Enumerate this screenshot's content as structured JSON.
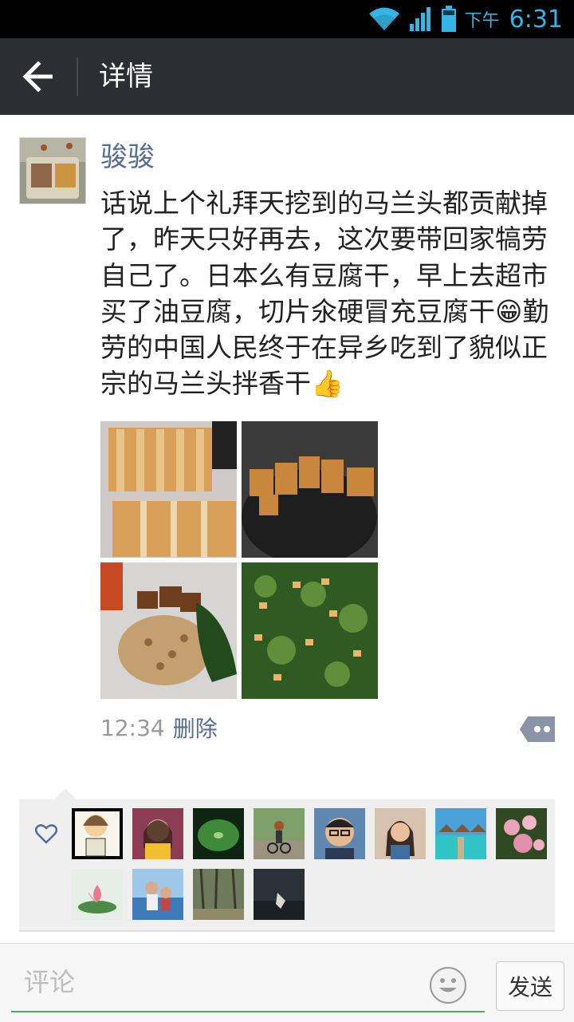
{
  "status_bar": {
    "ampm": "下午",
    "time": "6:31"
  },
  "header": {
    "title": "详情"
  },
  "post": {
    "username": "骏骏",
    "text": "话说上个礼拜天挖到的马兰头都贡献掉了，昨天只好再去，这次要带回家犒劳自己了。日本么有豆腐干，早上去超市买了油豆腐，切片氽硬冒充豆腐干😁勤劳的中国人民终于在异乡吃到了貌似正宗的马兰头拌香干👍",
    "photos": [
      {
        "icon": "photo-sliced-tofu"
      },
      {
        "icon": "photo-fried-tofu-pan"
      },
      {
        "icon": "photo-chopped-tofu-greens"
      },
      {
        "icon": "photo-malantou-salad"
      }
    ],
    "time": "12:34",
    "delete_label": "删除"
  },
  "likes": {
    "icon": "heart-icon",
    "avatars": [
      "avatar-cartoon",
      "avatar-woman-smiling",
      "avatar-lotus-leaf",
      "avatar-cyclist",
      "avatar-man-glasses",
      "avatar-woman-portrait",
      "avatar-beach-resort",
      "avatar-pink-roses",
      "avatar-lotus-flower",
      "avatar-child-beach",
      "avatar-forest-path",
      "avatar-dark-sky"
    ]
  },
  "comment_bar": {
    "placeholder": "评论",
    "send_label": "发送"
  },
  "colors": {
    "link": "#576b95",
    "accent_green": "#46b25c",
    "titlebar": "#2b2e33",
    "status_blue": "#33b5e5"
  }
}
